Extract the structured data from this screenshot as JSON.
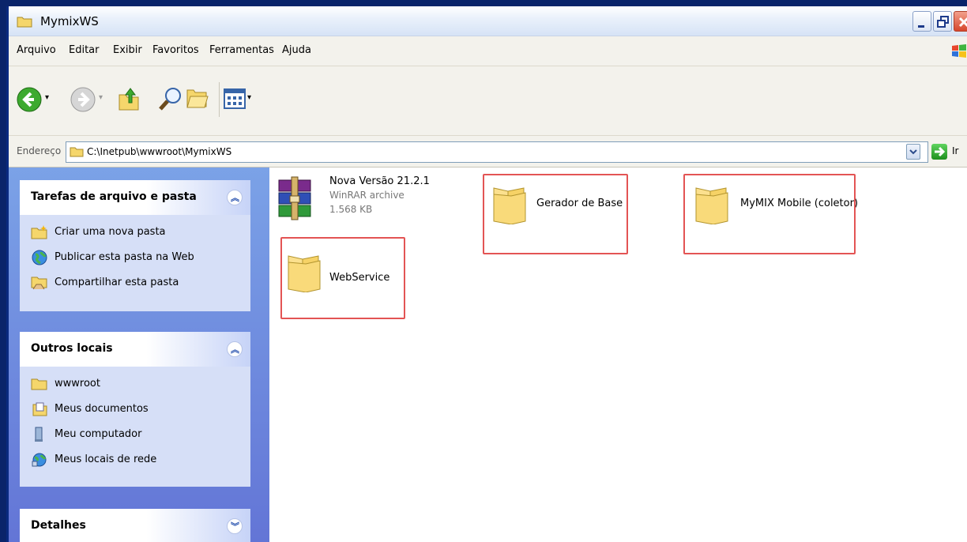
{
  "window": {
    "title": "MymixWS"
  },
  "menu": [
    "Arquivo",
    "Editar",
    "Exibir",
    "Favoritos",
    "Ferramentas",
    "Ajuda"
  ],
  "toolbar": {
    "icons": [
      "back-icon",
      "forward-icon",
      "up-folder-icon",
      "search-icon",
      "folders-icon",
      "views-icon"
    ]
  },
  "address": {
    "label": "Endereço",
    "path": "C:\\Inetpub\\wwwroot\\MymixWS",
    "go_label": "Ir"
  },
  "panels": {
    "tasks": {
      "title": "Tarefas de arquivo e pasta",
      "items": [
        "Criar uma nova pasta",
        "Publicar esta pasta na Web",
        "Compartilhar esta pasta"
      ]
    },
    "places": {
      "title": "Outros locais",
      "items": [
        "wwwroot",
        "Meus documentos",
        "Meu computador",
        "Meus locais de rede"
      ]
    },
    "details": {
      "title": "Detalhes"
    }
  },
  "files": [
    {
      "name": "Nova Versão 21.2.1",
      "type": "WinRAR archive",
      "size": "1.568 KB"
    },
    {
      "name": "Gerador de Base"
    },
    {
      "name": "MyMIX Mobile (coletor)"
    },
    {
      "name": "WebService"
    }
  ],
  "colors": {
    "highlight": "#e35454",
    "taskpane": "#6f8fe0",
    "titlebar": "#dce6f5"
  }
}
